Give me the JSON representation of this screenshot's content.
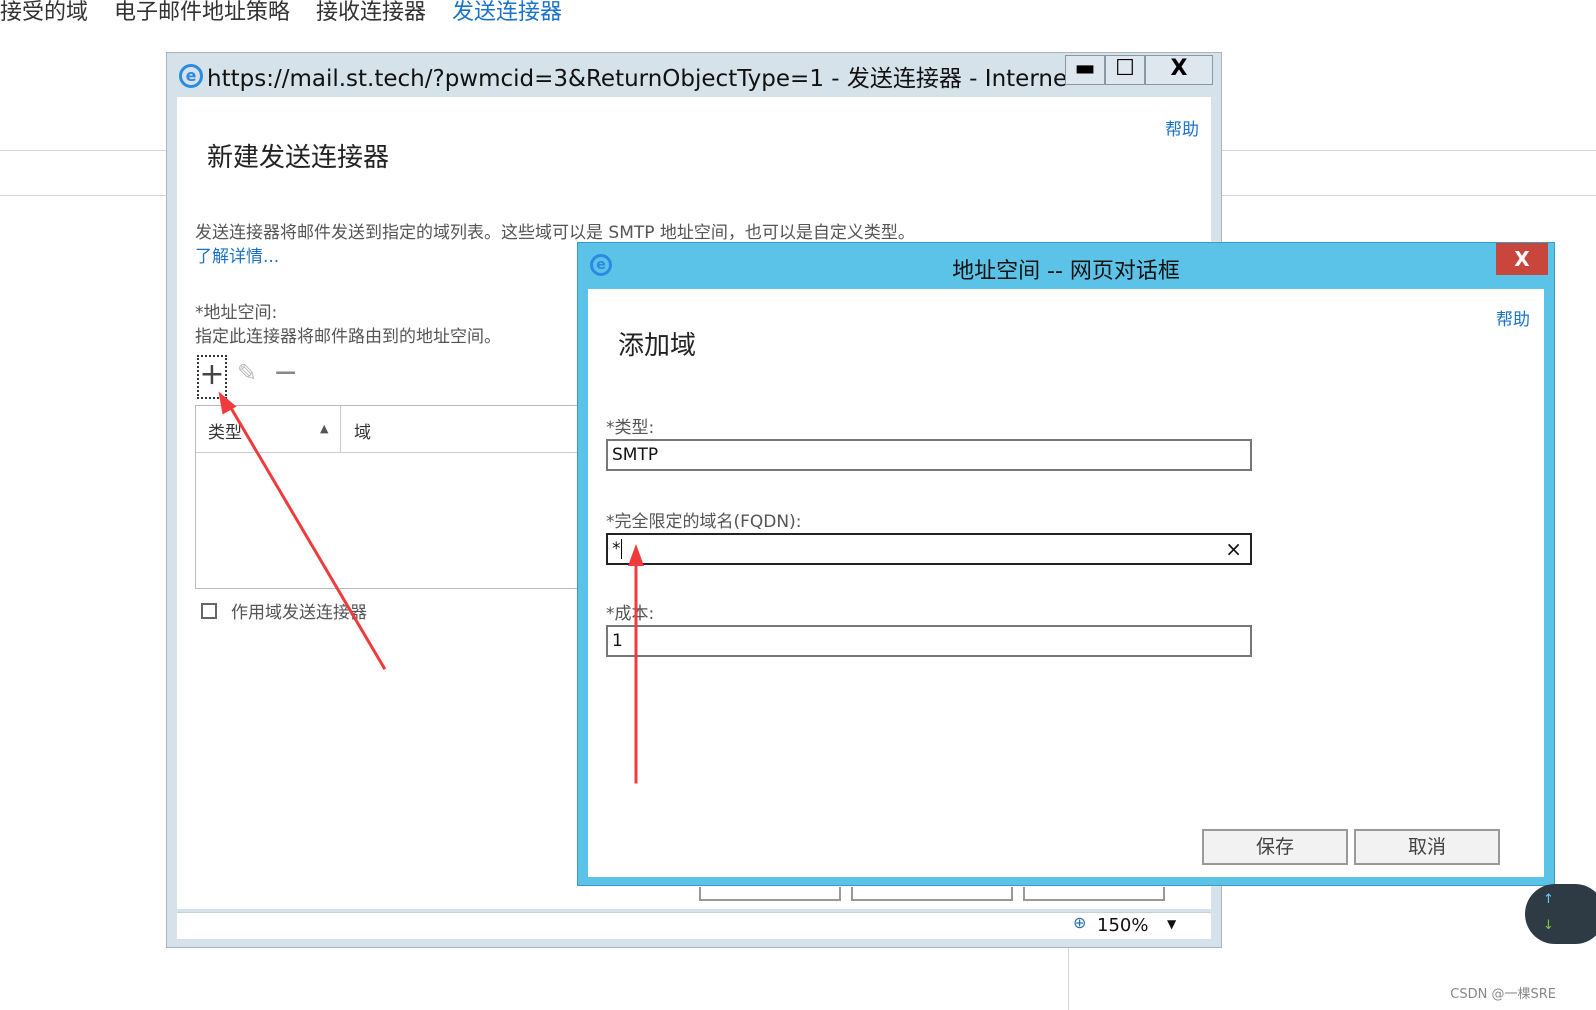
{
  "background": {
    "tabs": [
      {
        "label": "接受的域",
        "active": false
      },
      {
        "label": "电子邮件地址策略",
        "active": false
      },
      {
        "label": "接收连接器",
        "active": false
      },
      {
        "label": "发送连接器",
        "active": true
      }
    ]
  },
  "outer_window": {
    "title": "https://mail.st.tech/?pwmcid=3&ReturnObjectType=1 - 发送连接器 - Internet...",
    "minimize": "▬",
    "maximize": "☐",
    "close": "X",
    "help": "帮助",
    "heading": "新建发送连接器",
    "description": "发送连接器将邮件发送到指定的域列表。这些域可以是 SMTP 地址空间，也可以是自定义类型。",
    "learn_more": "了解详情...",
    "address_space_label": "*地址空间:",
    "address_space_desc": "指定此连接器将邮件路由到的地址空间。",
    "toolbar": {
      "add": "+",
      "edit": "✎",
      "remove": "−"
    },
    "table": {
      "col_type": "类型",
      "col_domain": "域",
      "sort_indicator": "▲"
    },
    "scoped_checkbox_label": "作用域发送连接器",
    "zoom": "150%"
  },
  "dialog": {
    "title": "地址空间 -- 网页对话框",
    "close": "X",
    "help": "帮助",
    "heading": "添加域",
    "type_label": "*类型:",
    "type_value": "SMTP",
    "fqdn_label": "*完全限定的域名(FQDN):",
    "fqdn_value": "*",
    "fqdn_clear": "×",
    "cost_label": "*成本:",
    "cost_value": "1",
    "save": "保存",
    "cancel": "取消"
  },
  "watermark": "CSDN @一棵SRE",
  "colors": {
    "accent": "#1a73c8",
    "dialog_frame": "#5cc3e8",
    "close_red": "#c9463d",
    "annotation": "#ef3b3b"
  }
}
